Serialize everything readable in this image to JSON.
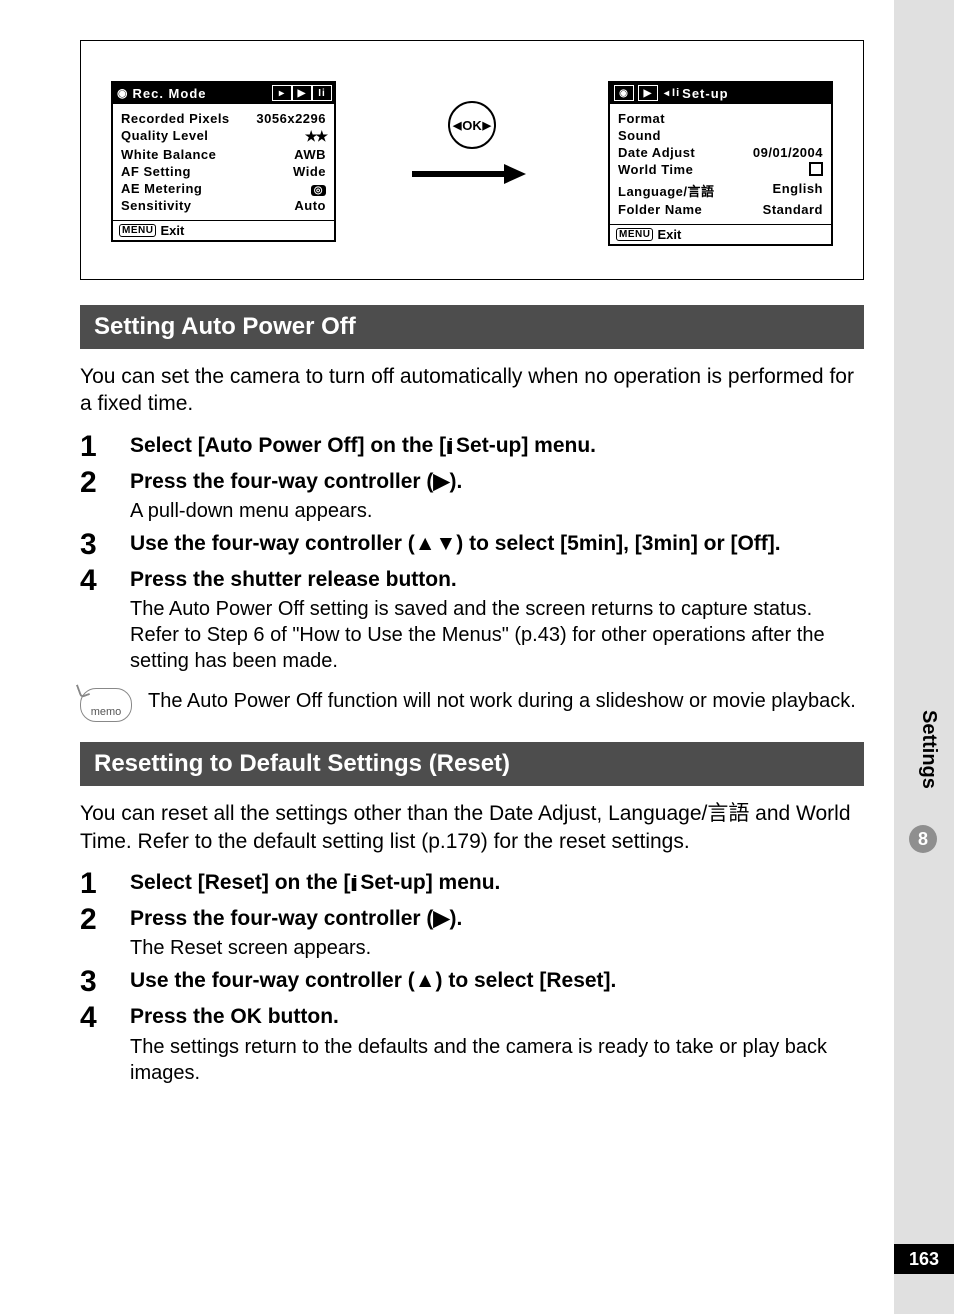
{
  "sidebar": {
    "label": "Settings",
    "chapter": "8"
  },
  "pageNumber": "163",
  "recMode": {
    "title": "Rec. Mode",
    "rows": [
      {
        "label": "Recorded Pixels",
        "value": "3056x2296"
      },
      {
        "label": "Quality Level",
        "value": "★★"
      },
      {
        "label": "White Balance",
        "value": "AWB"
      },
      {
        "label": "AF Setting",
        "value": "Wide"
      },
      {
        "label": "AE Metering",
        "value": "metering"
      },
      {
        "label": "Sensitivity",
        "value": "Auto"
      }
    ],
    "footer": "Exit",
    "menuLabel": "MENU"
  },
  "okLabel": "OK",
  "setup": {
    "title": "Set-up",
    "rows": [
      {
        "label": "Format",
        "value": ""
      },
      {
        "label": "Sound",
        "value": ""
      },
      {
        "label": "Date Adjust",
        "value": "09/01/2004"
      },
      {
        "label": "World Time",
        "value": "checkbox"
      },
      {
        "label": "Language/言語",
        "value": "English"
      },
      {
        "label": "Folder Name",
        "value": "Standard"
      }
    ],
    "footer": "Exit",
    "menuLabel": "MENU"
  },
  "section1": {
    "header": "Setting Auto Power Off",
    "intro": "You can set the camera to turn off automatically when no operation is performed for a fixed time.",
    "steps": [
      {
        "n": "1",
        "title_pre": "Select [Auto Power Off] on the [",
        "title_post": " Set-up] menu.",
        "desc": ""
      },
      {
        "n": "2",
        "title": "Press the four-way controller (▶).",
        "desc": "A pull-down menu appears."
      },
      {
        "n": "3",
        "title": "Use the four-way controller (▲▼) to select [5min], [3min] or [Off].",
        "desc": ""
      },
      {
        "n": "4",
        "title": "Press the shutter release button.",
        "desc": "The Auto Power Off setting is saved and the screen returns to capture status. Refer to Step 6 of \"How to Use the Menus\" (p.43) for other operations after the setting has been made."
      }
    ],
    "memo": "The Auto Power Off function will not work during a slideshow or movie playback.",
    "memoLabel": "memo"
  },
  "section2": {
    "header": "Resetting to Default Settings (Reset)",
    "intro_pre": "You can reset all the settings other than the Date Adjust, Language/",
    "intro_jp": "言語",
    "intro_post": " and World Time. Refer to the default setting list (p.179) for the reset settings.",
    "steps": [
      {
        "n": "1",
        "title_pre": "Select [Reset] on the [",
        "title_post": " Set-up] menu.",
        "desc": ""
      },
      {
        "n": "2",
        "title": "Press the four-way controller (▶).",
        "desc": "The Reset screen appears."
      },
      {
        "n": "3",
        "title": "Use the four-way controller (▲) to select [Reset].",
        "desc": ""
      },
      {
        "n": "4",
        "title_pre": "Press the ",
        "title_ok": "OK",
        "title_post": " button.",
        "desc": "The settings return to the defaults and the camera is ready to take or play back images."
      }
    ]
  }
}
